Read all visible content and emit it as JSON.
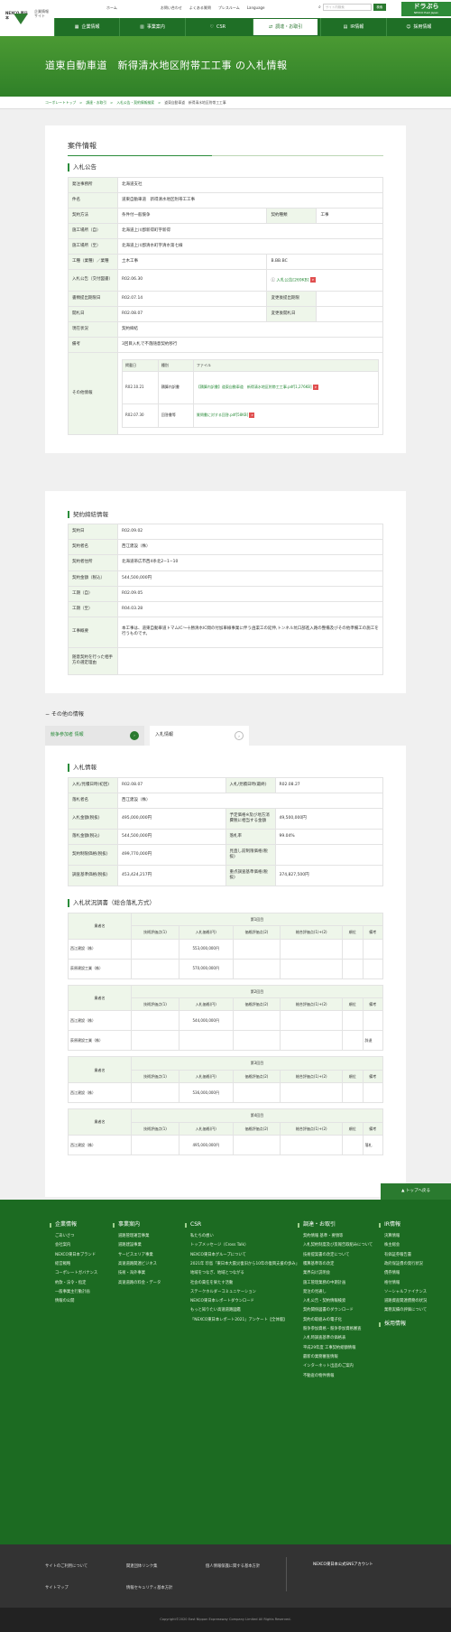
{
  "header": {
    "logo": "NEXCO 東日本",
    "corp_line1": "企業情報",
    "corp_line2": "サイト",
    "home": "ホーム",
    "util": [
      "お問い合わせ",
      "よくある質問",
      "プレスルーム",
      "Language"
    ],
    "search_placeholder": "サイト内検索",
    "search_btn": "検索",
    "brand": "ドラぷら",
    "brand_sub": "NEXCO East Japan",
    "gnav": [
      "企業情報",
      "事業案内",
      "CSR",
      "調達・お取引",
      "IR情報",
      "採用情報"
    ]
  },
  "hero_title": "道東自動車道　新得清水地区附帯工工事 の入札情報",
  "breadcrumb": [
    "コーポレートトップ",
    "調達・お取引",
    "入札公告・契約情報検索",
    "道東自動車道　新得清水地区附帯工工事"
  ],
  "section1": {
    "title": "案件情報",
    "h3": "入札公告",
    "rows": {
      "issuer_l": "発注事務所",
      "issuer": "北海道支社",
      "name_l": "件名",
      "name": "道東自動車道　新得清水地区附帯工工事",
      "method_l": "契約方法",
      "method": "条件付一般競争",
      "kind_l": "契約種類",
      "kind": "工事",
      "from_l": "施工場所（自）",
      "from": "北海道上川郡新得町字新得",
      "to_l": "施工場所（至）",
      "to": "北海道上川郡清水町字清水第七線",
      "work_l": "工種（業種）／業種",
      "work": "土木工事",
      "rank": "B.BB.BC",
      "notice_l": "入札公告（交付図書）",
      "notice_date": "R02.06.30",
      "notice_file": "入札公告[269KB]",
      "deadline_l": "書類提出期限日",
      "deadline": "R02.07.14",
      "chg1_l": "変更後提出期限",
      "open_l": "開札日",
      "open": "R02.08.07",
      "chg2_l": "変更後開札日",
      "status_l": "現在状況",
      "status": "契約締結",
      "remarks_l": "備考",
      "remarks": "3回目入札で不落随意契約移行",
      "other_l": "その他情報",
      "sub_heads": [
        "掲載日",
        "種別",
        "ファイル"
      ],
      "sub_rows": [
        [
          "R02.10.21",
          "積算内訳書",
          "【積算内訳書】道東自動車道　新得清水地区附帯工工事.pdf[1,276KB]"
        ],
        [
          "R02.07.30",
          "回答書等",
          "質問書に対する回答.pdf[58KB]"
        ]
      ]
    }
  },
  "section2": {
    "h3": "契約締結情報",
    "rows": [
      [
        "契約日",
        "R02.09.02"
      ],
      [
        "契約者名",
        "西江建設（株）"
      ],
      [
        "契約者住所",
        "北海道帯広市西4条北2−1−10"
      ],
      [
        "契約金額（税込）",
        "544,500,000円"
      ],
      [
        "工期（自）",
        "R02.09.05"
      ],
      [
        "工期（至）",
        "R04.03.28"
      ],
      [
        "工事概要",
        "本工事は、道東自動車道トマムIC〜十勝清水IC間の付加車線事業に伴う函渠工の延伸,トンネル坑口部進入路の整備及びその他準備工の施工を行うものです。"
      ],
      [
        "随意契約を行った相手方の選定理由",
        ""
      ]
    ]
  },
  "other_title": "− その他の情報",
  "tabs": [
    "競争参加者 情報",
    "入札情報"
  ],
  "section3": {
    "h3": "入札情報",
    "rows": [
      [
        "入札/見積日時(初回)",
        "R02.08.07",
        "入札/見積日時(最終)",
        "R02.08.27"
      ],
      [
        "落札者名",
        "西江建設（株）",
        "",
        ""
      ],
      [
        "入札金額(税抜)",
        "495,000,000円",
        "予定価格※及び地方消費税に相当する金額",
        "49,500,000円"
      ],
      [
        "落札金額(税込)",
        "544,500,000円",
        "落札率",
        "99.04%"
      ],
      [
        "契約制限価格(税抜)",
        "499,770,000円",
        "見直し前制限価格(税抜)",
        ""
      ],
      [
        "調査基準価格(税抜)",
        "453,424,217円",
        "重点調査基準価格(税抜)",
        "374,827,500円"
      ]
    ],
    "h3b": "入札状況調書（総合落札方式）",
    "bidder_l": "業者名",
    "cols": [
      "技術評価点(1)",
      "入札価格(円)",
      "価格評価点(2)",
      "総合評価点(1)+(2)",
      "順位",
      "備考"
    ],
    "rounds": [
      {
        "label": "第1回目",
        "rows": [
          [
            "西江建設（株）",
            "",
            "553,000,000円",
            "",
            "",
            "",
            ""
          ],
          [
            "荻原建設工業（株）",
            "",
            "570,000,000円",
            "",
            "",
            "",
            ""
          ]
        ]
      },
      {
        "label": "第2回目",
        "rows": [
          [
            "西江建設（株）",
            "",
            "544,000,000円",
            "",
            "",
            "",
            ""
          ],
          [
            "荻原建設工業（株）",
            "",
            "",
            "",
            "",
            "",
            "辞退"
          ]
        ]
      },
      {
        "label": "第3回目",
        "rows": [
          [
            "西江建設（株）",
            "",
            "536,000,000円",
            "",
            "",
            "",
            ""
          ]
        ]
      },
      {
        "label": "第4回目",
        "rows": [
          [
            "西江建設（株）",
            "",
            "495,000,000円",
            "",
            "",
            "",
            "落札"
          ]
        ]
      }
    ]
  },
  "totop": "トップへ戻る",
  "footer": {
    "cols": [
      {
        "h": "企業情報",
        "items": [
          "ごあいさつ",
          "会社案内",
          "NEXCO東日本ブランド",
          "経営戦略",
          "コーポレートガバナンス",
          "約款・法令・指定",
          "一般事業主行動計画",
          "情報の公開"
        ]
      },
      {
        "h": "事業案内",
        "items": [
          "道路管理運営事業",
          "道路建設事業",
          "サービスエリア事業",
          "高速道路関連ビジネス",
          "技術・海外事業",
          "高速道路の料金・データ"
        ]
      },
      {
        "h": "CSR",
        "items": [
          "私たちの想い",
          "トップメッセージ（Cross Talk）",
          "NEXCO東日本グループについて",
          "2021年 珍島「東日本大震災復旧から10年の復興支援の歩み」",
          "地域をつなぎ、地域とつながる",
          "社会の責任を果たす活動",
          "ステークホルダーコミュニケーション",
          "NEXCO東日本レポートダウンロード",
          "もっと知りたい高速道路図鑑",
          "「NEXCO東日本レポート2021」アンケート【全体版】"
        ]
      },
      {
        "h": "調達・お取引",
        "items": [
          "契約情報 基準・要領等",
          "入札契約制度及び反報告取組みについて",
          "技術提案書の改定について",
          "積算基準等の改定",
          "業界向け説明会",
          "施工管理業務の中期計画",
          "発注の見通し",
          "入札公告・契約情報検索",
          "契約関係図書のダウンロード",
          "契約の取組みの電子化",
          "競争参加資格・競争参加資格審査",
          "入札時調査基準の価格表",
          "平成29年度 工事契約総額情報",
          "最新の業務審査情報",
          "インターネット出品のご案内",
          "不動産の物件情報"
        ]
      },
      {
        "h": "IR情報",
        "items": [
          "決算情報",
          "株主総会",
          "有価証券報告書",
          "政府保証債の発行状況",
          "債券情報",
          "格付情報",
          "ソーシャルファイナンス",
          "道路資産関連債務の状況",
          "業務実績の評価について"
        ]
      }
    ],
    "recruit": "採用情報"
  },
  "subfooter": [
    "サイトのご利用について",
    "関連団体リンク集",
    "個人情報保護に関する基本方針",
    "サイトマップ",
    "情報セキュリティ基本方針",
    "NEXCO東日本公式SNSアカウント"
  ],
  "copyright": "Copyright©2020 East Nippon Expressway Company Limited All Rights Reserved."
}
